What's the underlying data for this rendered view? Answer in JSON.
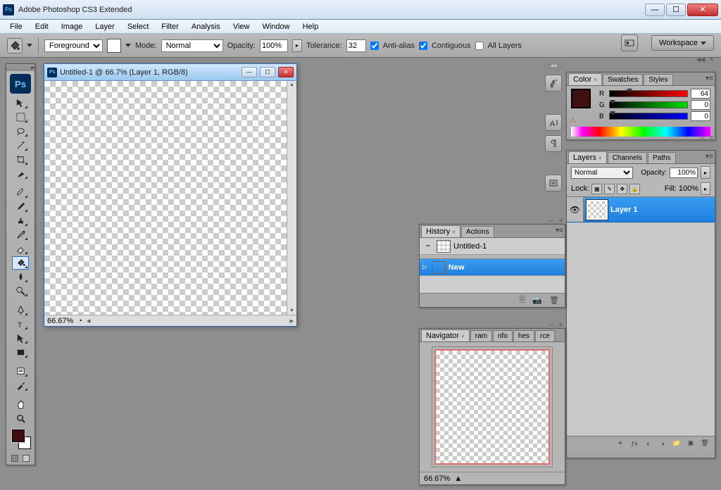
{
  "app": {
    "title": "Adobe Photoshop CS3 Extended",
    "logo_text": "Ps"
  },
  "menu": [
    "File",
    "Edit",
    "Image",
    "Layer",
    "Select",
    "Filter",
    "Analysis",
    "View",
    "Window",
    "Help"
  ],
  "options": {
    "fill_label": "Foreground",
    "mode_label": "Mode:",
    "mode_value": "Normal",
    "opacity_label": "Opacity:",
    "opacity_value": "100%",
    "tolerance_label": "Tolerance:",
    "tolerance_value": "32",
    "antialias_label": "Anti-alias",
    "antialias_checked": true,
    "contiguous_label": "Contiguous",
    "contiguous_checked": true,
    "alllayers_label": "All Layers",
    "alllayers_checked": false,
    "workspace_label": "Workspace"
  },
  "doc": {
    "title": "Untitled-1 @ 66.7% (Layer 1, RGB/8)",
    "zoom": "66.67%"
  },
  "color_panel": {
    "tabs": [
      "Color",
      "Swatches",
      "Styles"
    ],
    "r_label": "R",
    "r_value": "64",
    "g_label": "G",
    "g_value": "0",
    "b_label": "B",
    "b_value": "0"
  },
  "layers_panel": {
    "tabs": [
      "Layers",
      "Channels",
      "Paths"
    ],
    "blend": "Normal",
    "opacity_label": "Opacity:",
    "opacity_value": "100%",
    "lock_label": "Lock:",
    "fill_label": "Fill:",
    "fill_value": "100%",
    "layer_name": "Layer 1"
  },
  "history_panel": {
    "tabs": [
      "History",
      "Actions"
    ],
    "snapshot": "Untitled-1",
    "step": "New"
  },
  "navigator_panel": {
    "tabs": [
      "Navigator",
      "ram",
      "nfo",
      "hes",
      "rce"
    ],
    "zoom": "66.67%"
  }
}
